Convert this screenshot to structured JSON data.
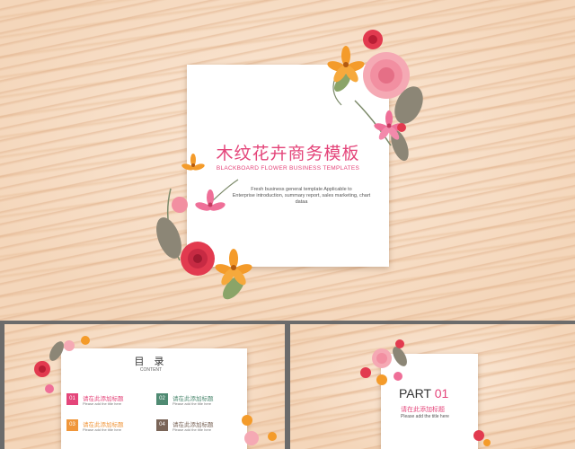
{
  "slides": {
    "main": {
      "title": "木纹花卉商务模板",
      "subtitle": "BLACKBOARD FLOWER BUSINESS TEMPLATES",
      "description_line1": "Fresh business general template Applicable to",
      "description_line2": "Enterprise introduction, summary report,  sales marketing, chart",
      "description_line3": "dataa"
    },
    "toc": {
      "title": "目 录",
      "title_en": "CONTENT",
      "items": [
        {
          "num": "01",
          "label": "请在此添加标题",
          "sub": "Please add the title here",
          "color": "#e4457a"
        },
        {
          "num": "02",
          "label": "请在此添加标题",
          "sub": "Please add the title here",
          "color": "#4f8a72"
        },
        {
          "num": "03",
          "label": "请在此添加标题",
          "sub": "Please add the title here",
          "color": "#f0963a"
        },
        {
          "num": "04",
          "label": "请在此添加标题",
          "sub": "Please add the title here",
          "color": "#7a6558"
        }
      ]
    },
    "part": {
      "prefix": "PART",
      "number": "01",
      "label": "请在此添加标题",
      "sub": "Please add the title here"
    }
  },
  "colors": {
    "accent_pink": "#e4457a",
    "wood": "#f6dcc3"
  }
}
